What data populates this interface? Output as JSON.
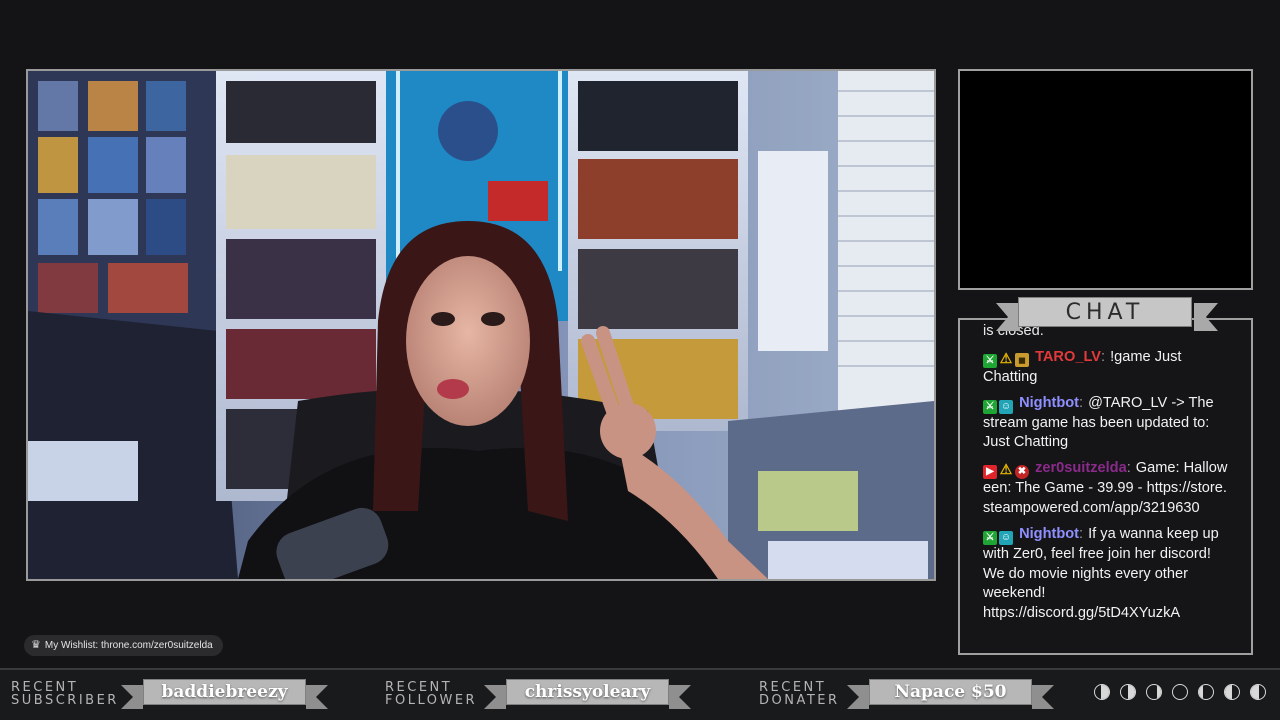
{
  "chat": {
    "title": "CHAT",
    "clipped_text": "is closed.",
    "messages": [
      {
        "user": "TARO_LV",
        "user_color": "#e23a3a",
        "badges": [
          "mod-icon",
          "warning-icon",
          "rank-icon"
        ],
        "text": "!game Just Chatting"
      },
      {
        "user": "Nightbot",
        "user_color": "#8f8fff",
        "badges": [
          "mod-icon",
          "bot-icon"
        ],
        "text": "@TARO_LV -> The stream game has been updated to: Just Chatting"
      },
      {
        "user": "zer0suitzelda",
        "user_color": "#8a2a8a",
        "badges": [
          "broadcaster-icon",
          "warning-icon",
          "skull-icon"
        ],
        "text": "Game: Halloween: The Game - 39.99 - https://store.steampowered.com/app/3219630"
      },
      {
        "user": "Nightbot",
        "user_color": "#8f8fff",
        "badges": [
          "mod-icon",
          "bot-icon"
        ],
        "text": "If ya wanna keep up with Zer0, feel free join her discord! We do movie nights every other weekend! https://discord.gg/5tD4XYuzkA"
      }
    ]
  },
  "wishlist": {
    "icon": "crown-icon",
    "text": "My Wishlist: throne.com/zer0suitzelda"
  },
  "recent": {
    "subscriber": {
      "line1": "RECENT",
      "line2": "SUBSCRIBER",
      "name": "baddiebreezy"
    },
    "follower": {
      "line1": "RECENT",
      "line2": "FOLLOWER",
      "name": "chrissyoleary"
    },
    "donater": {
      "line1": "RECENT",
      "line2": "DONATER",
      "name": "Napace $50"
    }
  },
  "moon_phases": [
    "waxing-crescent-icon",
    "first-quarter-icon",
    "waxing-gibbous-icon",
    "full-moon-icon",
    "waning-gibbous-icon",
    "last-quarter-icon",
    "waning-crescent-icon"
  ],
  "colors": {
    "background": "#141416",
    "frame_border": "#9a9a9a",
    "ribbon": "#b7b7b7"
  }
}
